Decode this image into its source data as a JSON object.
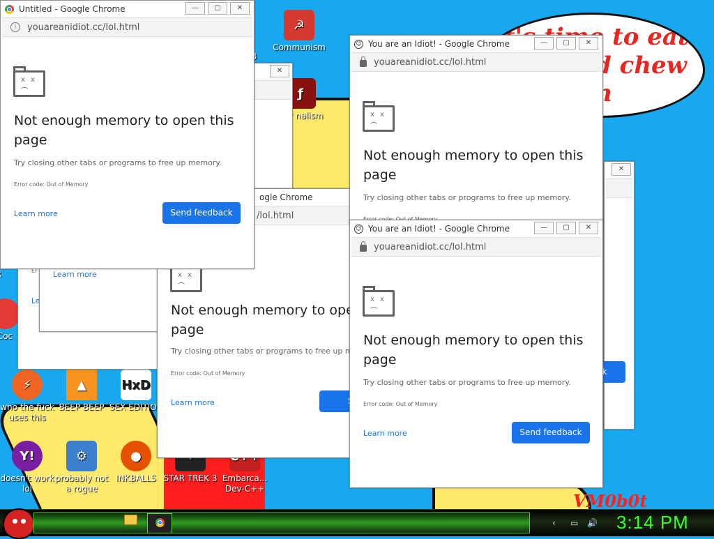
{
  "speech_bubble": {
    "lines": [
      "it's time to eat shit",
      "d chew",
      "n"
    ]
  },
  "desktop_icons": [
    {
      "label": "Communism"
    },
    {
      "label": "who the fuck uses this"
    },
    {
      "label": "BEEP BEEP"
    },
    {
      "label": "SEX EDITIOR"
    },
    {
      "label": "doesn't work lol"
    },
    {
      "label": "probably not a rogue"
    },
    {
      "label": "INKBALLS"
    },
    {
      "label": "STAR TREK 3"
    },
    {
      "label": "Embarca... Dev-C++"
    },
    {
      "label": "yay nalism"
    },
    {
      "label": "Coc"
    },
    {
      "label": "R"
    },
    {
      "label": "B"
    }
  ],
  "error_page": {
    "title": "Not enough memory to open this page",
    "text": "Try closing other tabs or programs to free up memory.",
    "code": "Error code: Out of Memory",
    "learn_more": "Learn more",
    "feedback": "Send feedback"
  },
  "windows": {
    "untitled": {
      "title": "Untitled - Google Chrome",
      "url": "youareanidiot.cc/lol.html"
    },
    "idiot": {
      "title": "You are an Idiot! - Google Chrome",
      "url": "youareanidiot.cc/lol.html"
    },
    "middle": {
      "title": "ogle Chrome",
      "url": "/lol.html"
    },
    "partial_title": "Send",
    "partial_button": "k",
    "partial_small_title": "Er",
    "partial_small_e": "E",
    "partial_small_le": "Le"
  },
  "watermark": "VM0b0t",
  "taskbar": {
    "clock": "3:14 PM"
  },
  "colors": {
    "desktop": "#18a8f0",
    "chrome_button": "#1a73e8",
    "clock": "#39ff2c"
  }
}
